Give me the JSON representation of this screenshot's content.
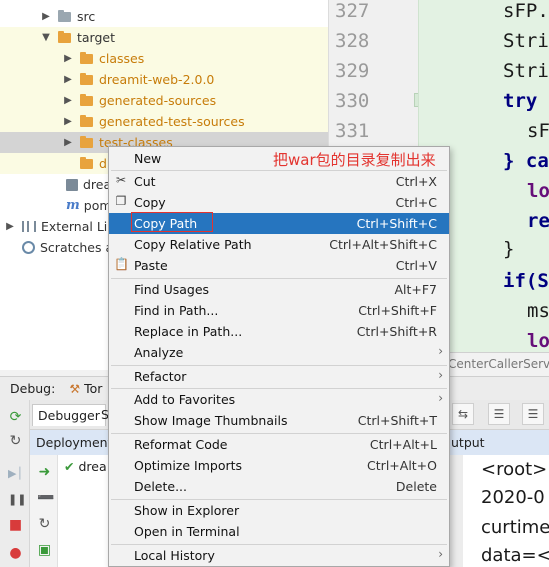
{
  "project_tree": {
    "rows": [
      {
        "label": "src",
        "icon": "folder-icon",
        "expanded": false
      },
      {
        "label": "target",
        "icon": "folder-icon",
        "expanded": true
      },
      {
        "label": "classes",
        "icon": "folder-icon"
      },
      {
        "label": "dreamit-web-2.0.0",
        "icon": "folder-icon"
      },
      {
        "label": "generated-sources",
        "icon": "folder-icon"
      },
      {
        "label": "generated-test-sources",
        "icon": "folder-icon"
      },
      {
        "label": "test-classes",
        "icon": "folder-icon"
      },
      {
        "label": "d",
        "icon": "folder-icon"
      },
      {
        "label": "drea",
        "icon": "jar-icon"
      },
      {
        "label": "pom",
        "icon": "maven-icon"
      },
      {
        "label": "External Libr",
        "icon": "library-icon"
      },
      {
        "label": "Scratches a",
        "icon": "scratches-icon"
      }
    ]
  },
  "editor": {
    "line_numbers": [
      "327",
      "328",
      "329",
      "330",
      "331"
    ],
    "code_lines": [
      "sFP.a",
      "String",
      "String",
      "try {",
      "sFi",
      "} catc",
      "log",
      "retu",
      "}",
      "if(Str",
      "ms",
      "log"
    ],
    "file_tab": "CenterCallerServic"
  },
  "debug": {
    "title": "Debug:",
    "tab": "Tor",
    "subtabs": [
      "Debugger",
      "S"
    ],
    "deployment_header": "Deployment",
    "deployment_item": "drea",
    "output_header": "utput",
    "output_lines": [
      "<root>",
      "2020-0",
      "curtime",
      "data=<"
    ]
  },
  "context_menu": {
    "items": [
      {
        "label": "New",
        "shortcut": "",
        "submenu": true
      },
      {
        "label": "Cut",
        "shortcut": "Ctrl+X",
        "icon": "scissors-icon"
      },
      {
        "label": "Copy",
        "shortcut": "Ctrl+C",
        "icon": "copy-icon"
      },
      {
        "label": "Copy Path",
        "shortcut": "Ctrl+Shift+C",
        "selected": true
      },
      {
        "label": "Copy Relative Path",
        "shortcut": "Ctrl+Alt+Shift+C"
      },
      {
        "label": "Paste",
        "shortcut": "Ctrl+V",
        "icon": "paste-icon"
      },
      {
        "label": "Find Usages",
        "shortcut": "Alt+F7"
      },
      {
        "label": "Find in Path...",
        "shortcut": "Ctrl+Shift+F"
      },
      {
        "label": "Replace in Path...",
        "shortcut": "Ctrl+Shift+R"
      },
      {
        "label": "Analyze",
        "shortcut": "",
        "submenu": true
      },
      {
        "label": "Refactor",
        "shortcut": "",
        "submenu": true
      },
      {
        "label": "Add to Favorites",
        "shortcut": "",
        "submenu": true
      },
      {
        "label": "Show Image Thumbnails",
        "shortcut": "Ctrl+Shift+T"
      },
      {
        "label": "Reformat Code",
        "shortcut": "Ctrl+Alt+L"
      },
      {
        "label": "Optimize Imports",
        "shortcut": "Ctrl+Alt+O"
      },
      {
        "label": "Delete...",
        "shortcut": "Delete"
      },
      {
        "label": "Show in Explorer",
        "shortcut": ""
      },
      {
        "label": "Open in Terminal",
        "shortcut": ""
      },
      {
        "label": "Local History",
        "shortcut": "",
        "submenu": true
      }
    ]
  },
  "annotation": {
    "text": "把war包的目录复制出来",
    "color": "#e3342f"
  },
  "colors": {
    "selection": "#2675bf",
    "editor_bg": "#e3f2e3",
    "folder_orange": "#e8a33d"
  }
}
